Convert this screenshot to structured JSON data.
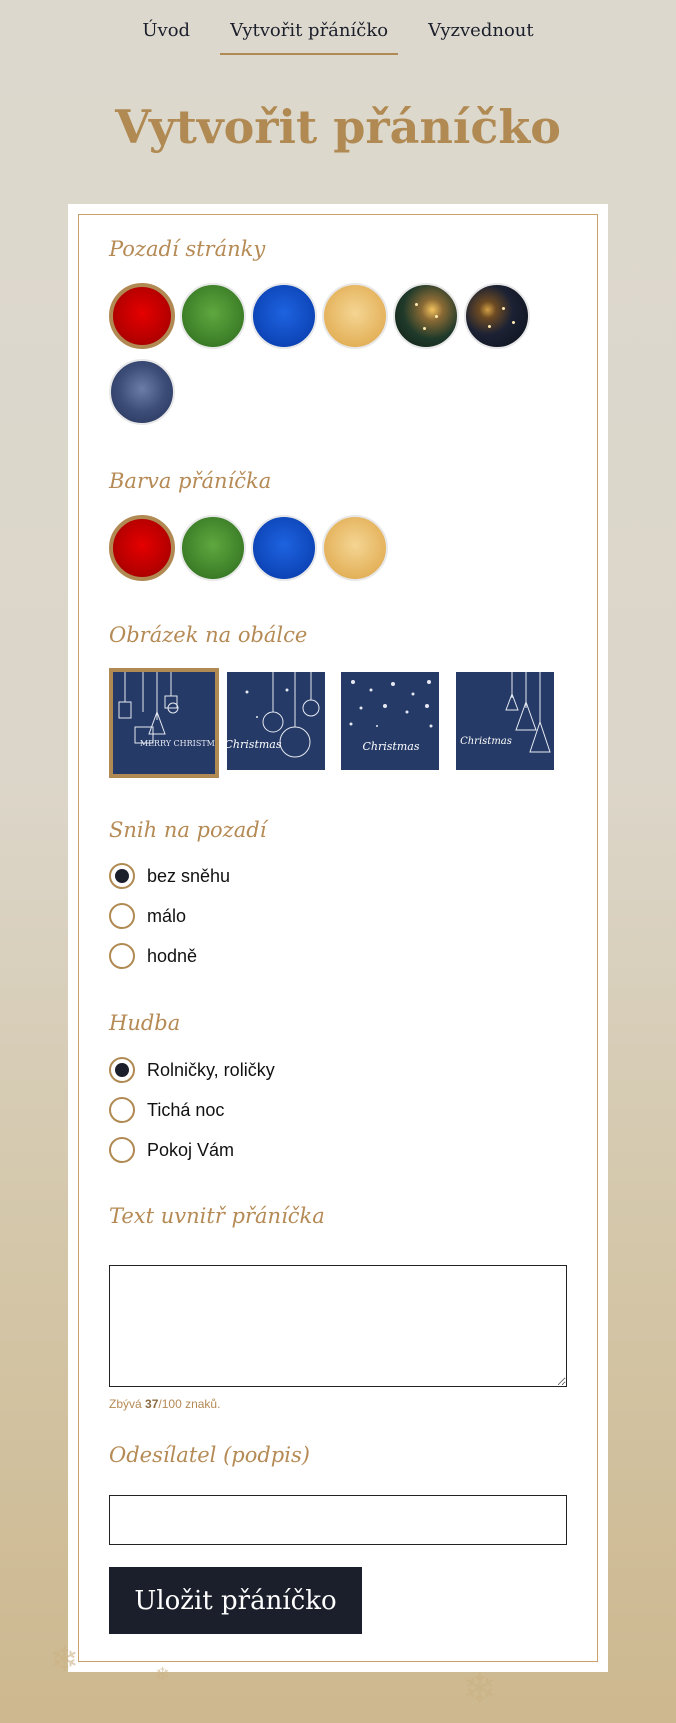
{
  "nav": {
    "items": [
      "Úvod",
      "Vytvořit přáníčko",
      "Vyzvednout"
    ],
    "active_index": 1
  },
  "page_title": "Vytvořit přáníčko",
  "form": {
    "background": {
      "title": "Pozadí stránky",
      "options": [
        "red",
        "green",
        "blue",
        "gold",
        "photo-lights",
        "photo-ornaments",
        "photo-snow-texture"
      ],
      "selected": "red"
    },
    "card_color": {
      "title": "Barva přáníčka",
      "options": [
        "red",
        "green",
        "blue",
        "gold"
      ],
      "selected": "red"
    },
    "envelope_image": {
      "title": "Obrázek na obálce",
      "options": [
        {
          "name": "gifts-stocking",
          "text": "MERRY CHRISTMAS"
        },
        {
          "name": "hanging-baubles",
          "text": "Christmas"
        },
        {
          "name": "snowflakes",
          "text": "Christmas"
        },
        {
          "name": "trees",
          "text": "Christmas"
        }
      ],
      "selected_index": 0
    },
    "snow": {
      "title": "Snih na pozadí",
      "options": [
        "bez sněhu",
        "málo",
        "hodně"
      ],
      "selected_index": 0
    },
    "music": {
      "title": "Hudba",
      "options": [
        "Rolničky, roličky",
        "Tichá noc",
        "Pokoj Vám"
      ],
      "selected_index": 0
    },
    "text": {
      "title": "Text uvnitř přáníčka",
      "value": "",
      "counter_prefix": "Zbývá",
      "counter_remaining": "37",
      "counter_suffix": "/100 znaků."
    },
    "sender": {
      "title": "Odesílatel (podpis)",
      "value": ""
    },
    "save_label": "Uložit přáníčko"
  },
  "colors": {
    "accent": "#b08a52",
    "dark": "#1b1f2b",
    "cover_blue": "#253a66"
  }
}
